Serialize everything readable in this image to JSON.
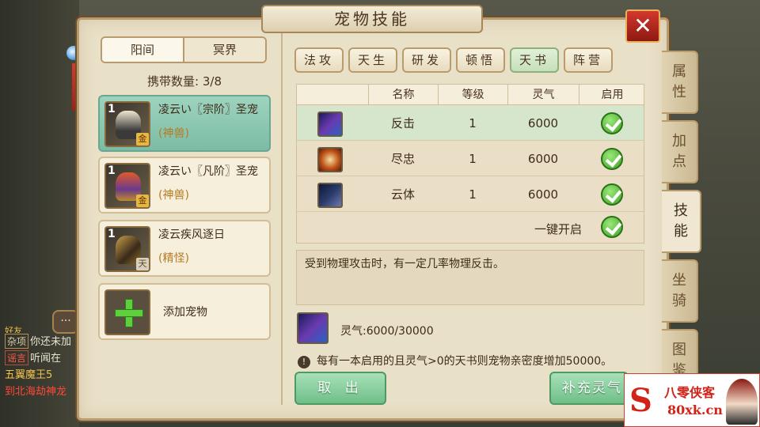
{
  "title": "宠物技能",
  "close_label": "✕",
  "world_tabs": [
    {
      "label": "阳间",
      "active": true
    },
    {
      "label": "冥界",
      "active": false
    }
  ],
  "carry": {
    "label": "携带数量:",
    "value": "3/8"
  },
  "pets": [
    {
      "level": "1",
      "grade": "金",
      "name": "凌云い〖宗阶〗圣宠",
      "kind": "(神兽)",
      "selected": true
    },
    {
      "level": "1",
      "grade": "金",
      "name": "凌云い〖凡阶〗圣宠",
      "kind": "(神兽)",
      "selected": false
    },
    {
      "level": "1",
      "grade": "天",
      "name": "凌云疾风逐日",
      "kind": "(精怪)",
      "selected": false
    }
  ],
  "add_pet_label": "添加宠物",
  "skill_tabs": [
    {
      "label": "法攻",
      "active": false
    },
    {
      "label": "天生",
      "active": false
    },
    {
      "label": "研发",
      "active": false
    },
    {
      "label": "顿悟",
      "active": false
    },
    {
      "label": "天书",
      "active": true
    },
    {
      "label": "阵营",
      "active": false
    }
  ],
  "table": {
    "headers": [
      "名称",
      "等级",
      "灵气",
      "启用"
    ],
    "rows": [
      {
        "icon": "claw-strike-icon",
        "name": "反击",
        "level": "1",
        "lingqi": "6000",
        "enabled": true
      },
      {
        "icon": "loyalty-icon",
        "name": "尽忠",
        "level": "1",
        "lingqi": "6000",
        "enabled": true
      },
      {
        "icon": "cloud-body-icon",
        "name": "云体",
        "level": "1",
        "lingqi": "6000",
        "enabled": true
      }
    ],
    "one_key_label": "一键开启"
  },
  "description": "受到物理攻击时，有一定几率物理反击。",
  "lingqi_status": "灵气:6000/30000",
  "notice": "每有一本启用的且灵气>0的天书则宠物亲密度增加50000。",
  "buttons": {
    "exit": "取 出",
    "refill": "补充灵气"
  },
  "side_tabs": [
    {
      "label": "属\n性",
      "active": false
    },
    {
      "label": "加\n点",
      "active": false
    },
    {
      "label": "技\n能",
      "active": true
    },
    {
      "label": "坐\n骑",
      "active": false
    },
    {
      "label": "图\n鉴",
      "active": false
    }
  ],
  "chat": {
    "bubble": "···",
    "friend_tag": "好友",
    "lines": [
      {
        "tag": "杂项",
        "text": "你还未加"
      },
      {
        "tag": "谣言",
        "text": "听闻在"
      },
      {
        "tag": "",
        "text": "五翼魔王5"
      },
      {
        "tag": "",
        "text": "到北海劫神龙"
      }
    ]
  },
  "watermark": {
    "brand": "八零侠客",
    "url": "80xk.cn",
    "logo": "S"
  },
  "colors": {
    "accent_green": "#6fbf88",
    "selected_row": "#d6e6cc",
    "panel": "#e9e0c8",
    "close_red": "#d2382c"
  }
}
